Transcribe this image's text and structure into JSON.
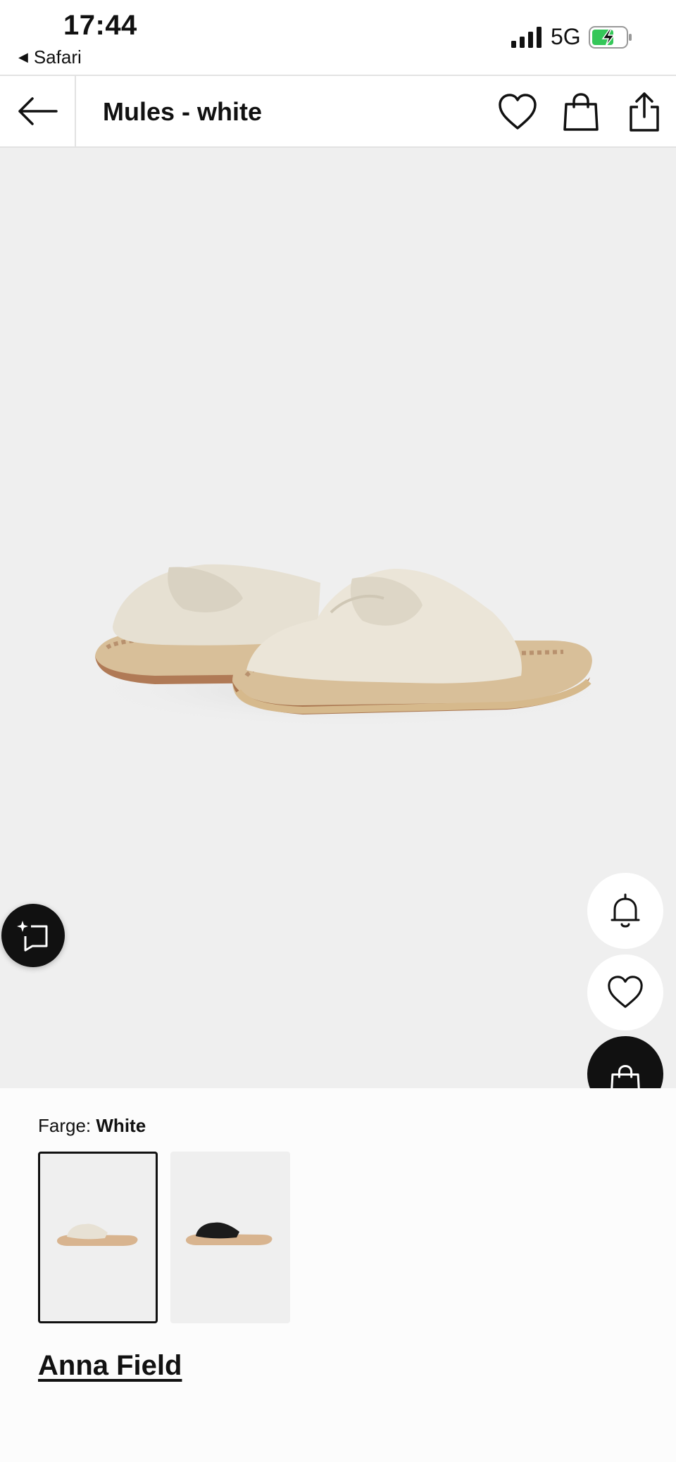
{
  "status_bar": {
    "time": "17:44",
    "back_app": "Safari",
    "network": "5G",
    "icons": [
      "signal-bars",
      "battery-charging"
    ]
  },
  "header": {
    "title": "Mules - white",
    "icons": [
      "back-arrow-icon",
      "heart-icon",
      "bag-icon",
      "share-icon"
    ]
  },
  "product_image": {
    "floating_buttons": [
      "ai-assistant",
      "notify-bell",
      "wishlist-heart",
      "add-to-bag"
    ]
  },
  "color": {
    "label": "Farge:",
    "value": "White",
    "swatches": [
      {
        "name": "White",
        "selected": true,
        "shoe_color": "#e7e1d4"
      },
      {
        "name": "Black",
        "selected": false,
        "shoe_color": "#1b1b1b"
      }
    ]
  },
  "brand": "Anna Field",
  "colors": {
    "background": "#efefef",
    "accent": "#111111",
    "battery_green": "#35c759"
  }
}
